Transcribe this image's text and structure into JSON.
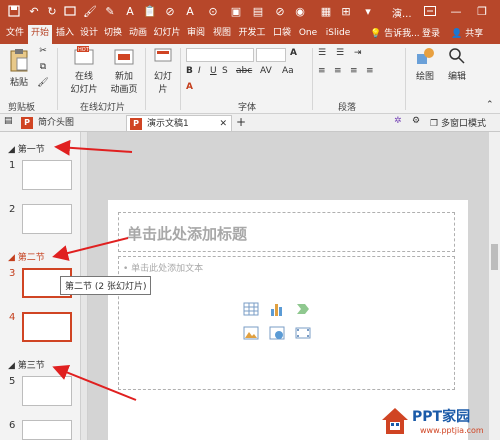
{
  "colors": {
    "accent": "#b7472a",
    "arrow": "#e02020",
    "selected_border": "#d04423"
  },
  "titlebar": {
    "icons": [
      "save-icon",
      "undo-icon",
      "redo-icon",
      "slideshow-start-icon",
      "format-painter-icon",
      "pen-icon",
      "a-glyph-icon",
      "clipboard-icon",
      "link-icon",
      "record-icon",
      "image-icon",
      "grid-icon",
      "ribbon-display-options-icon",
      "minimize-icon",
      "restore-icon"
    ],
    "doc_title": "演..."
  },
  "tabs": [
    "文件",
    "开始",
    "插入",
    "设计",
    "切换",
    "动画",
    "幻灯片",
    "审阅",
    "视图",
    "开发工",
    "口袋",
    "One",
    "iSlide"
  ],
  "active_tab": "开始",
  "tell_me": "告诉我...",
  "login": "登录",
  "share": "共享",
  "ribbon": {
    "paste": "粘贴",
    "clipboard_group": "剪贴板",
    "online_slides": "在线",
    "online_slides2": "幻灯片",
    "new_anim": "新加",
    "new_anim2": "动画页",
    "online_group": "在线幻灯片",
    "slides_btn": "幻灯片",
    "font_group": "字体",
    "para_group": "段落",
    "drawing": "绘图",
    "editing": "编辑"
  },
  "doc_tabs": [
    {
      "label": "简介头图"
    },
    {
      "label": "演示文稿1"
    }
  ],
  "doc_tab_tools": {
    "multi_window": "多窗口模式"
  },
  "sections": [
    {
      "label": "第一节"
    },
    {
      "label": "第二节"
    },
    {
      "label": "第三节"
    }
  ],
  "slide_numbers": [
    "1",
    "2",
    "3",
    "4",
    "5",
    "6"
  ],
  "tooltip": "第二节 (2 张幻灯片)",
  "slide": {
    "title_placeholder": "单击此处添加标题",
    "body_placeholder": "• 单击此处添加文本"
  },
  "watermark": {
    "brand": "PPT家园",
    "url": "www.pptjia.com"
  }
}
